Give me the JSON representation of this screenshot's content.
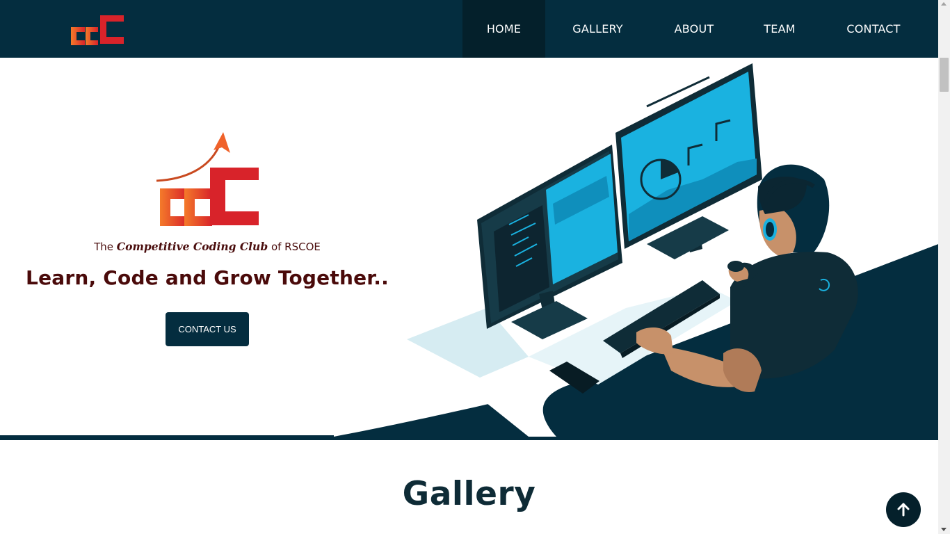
{
  "brand": {
    "logo_text": "ccC"
  },
  "nav": {
    "items": [
      {
        "label": "HOME",
        "active": true
      },
      {
        "label": "GALLERY"
      },
      {
        "label": "ABOUT"
      },
      {
        "label": "TEAM"
      },
      {
        "label": "CONTACT"
      }
    ]
  },
  "hero": {
    "tagline_prefix": "The",
    "tagline_club": "Competitive Coding Club",
    "tagline_suffix": "of RSCOE",
    "headline": "Learn, Code and Grow Together..",
    "cta_label": "CONTACT US",
    "illustration": "developer-at-dual-monitors-illustration"
  },
  "gallery": {
    "title": "Gallery"
  },
  "back_to_top": {
    "icon": "arrow-up-icon"
  },
  "colors": {
    "navy": "#042d3f",
    "nav_active": "#04202b",
    "maroon_text": "#4a0d0d",
    "accent_cyan": "#1ab2e0",
    "logo_orange": "#f0622a",
    "logo_red": "#d8232a",
    "skin": "#c7916a"
  }
}
